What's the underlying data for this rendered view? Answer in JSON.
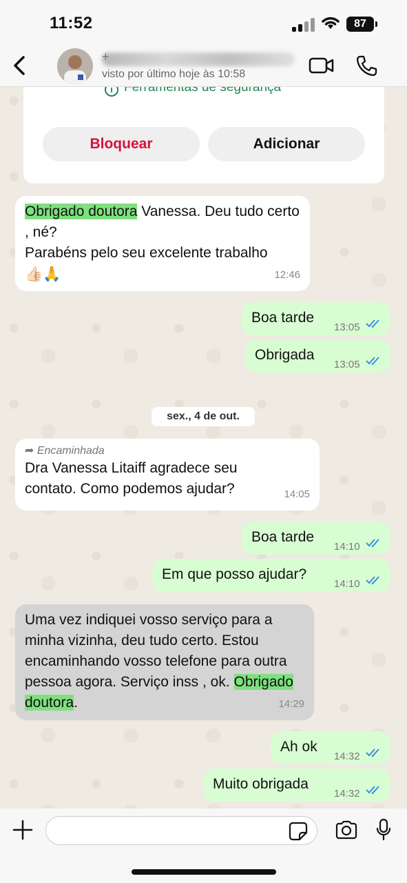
{
  "status": {
    "time": "11:52",
    "battery": "87"
  },
  "header": {
    "name_visible_char": "+",
    "last_seen": "visto por último hoje às 10:58"
  },
  "safety_card": {
    "tools_label": "Ferramentas de segurança",
    "block_label": "Bloquear",
    "add_label": "Adicionar"
  },
  "messages": [
    {
      "dir": "in",
      "highlight": "Obrigado doutora",
      "rest": " Vanessa.  Deu tudo certo , né?",
      "line2": "Parabéns pelo seu excelente trabalho",
      "emoji": "👍🏻🙏",
      "time": "12:46"
    },
    {
      "dir": "out",
      "text": "Boa tarde",
      "time": "13:05"
    },
    {
      "dir": "out",
      "text": "Obrigada",
      "time": "13:05"
    },
    {
      "dir": "in",
      "forwarded_label": "Encaminhada",
      "text": "Dra Vanessa Litaiff agradece seu contato. Como podemos ajudar?",
      "time": "14:05"
    },
    {
      "dir": "out",
      "text": "Boa tarde",
      "time": "14:10"
    },
    {
      "dir": "out",
      "text": "Em que posso ajudar?",
      "time": "14:10"
    },
    {
      "dir": "in",
      "text": "Uma vez indiquei vosso serviço para a minha vizinha,  deu tudo certo.  Estou encaminhando vosso telefone para outra pessoa agora.  Serviço inss , ok. ",
      "highlight": "Obrigado doutora",
      "end": ".",
      "time": "14:29"
    },
    {
      "dir": "out",
      "text": "Ah ok",
      "time": "14:32"
    },
    {
      "dir": "out",
      "text": "Muito obrigada",
      "time": "14:32"
    }
  ],
  "date_chip": "sex., 4 de out.",
  "composer": {
    "placeholder": ""
  },
  "colors": {
    "accent_green": "#1b8a53",
    "block_red": "#d6123b",
    "outgoing_bubble": "#d9fdd3",
    "tick_blue": "#3b8fe0",
    "highlight": "#7ee07e"
  }
}
